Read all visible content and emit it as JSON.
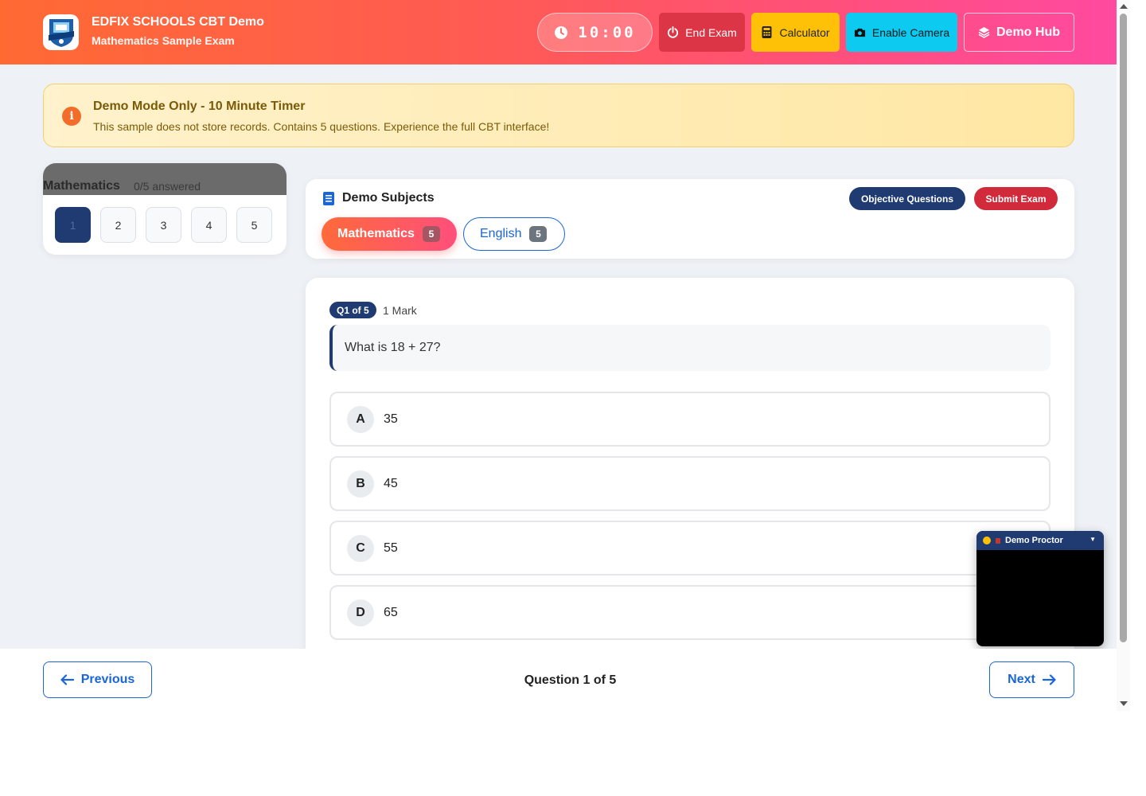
{
  "header": {
    "title": "EDFIX SCHOOLS CBT Demo",
    "subtitle": "Mathematics Sample Exam",
    "timer": "10:00",
    "end_exam_label": "End Exam",
    "calculator_label": "Calculator",
    "camera_label": "Enable Camera",
    "demo_hub_label": "Demo Hub"
  },
  "alert": {
    "title": "Demo Mode Only - 10 Minute Timer",
    "text": "This sample does not store records. Contains 5 questions. Experience the full CBT interface!"
  },
  "navigator": {
    "subject": "Mathematics",
    "answered": "0/5 answered",
    "questions": [
      "1",
      "2",
      "3",
      "4",
      "5"
    ],
    "active_index": 0
  },
  "subjects": {
    "title": "Demo Subjects",
    "objective_label": "Objective Questions",
    "submit_label": "Submit Exam",
    "tabs": [
      {
        "label": "Mathematics",
        "count": "5"
      },
      {
        "label": "English",
        "count": "5"
      }
    ]
  },
  "question": {
    "badge": "Q1 of 5",
    "marks": "1 Mark",
    "text": "What is 18 + 27?",
    "options": [
      {
        "letter": "A",
        "text": "35"
      },
      {
        "letter": "B",
        "text": "45"
      },
      {
        "letter": "C",
        "text": "55"
      },
      {
        "letter": "D",
        "text": "65"
      }
    ]
  },
  "proctor": {
    "title": "Demo Proctor"
  },
  "footer": {
    "previous_label": "Previous",
    "next_label": "Next",
    "position_label": "Question 1 of 5"
  },
  "colors": {
    "primary": "#1f3b72",
    "accent": "#ff5a55",
    "danger": "#dc3545",
    "warning": "#ffc107",
    "info": "#0dcaf0",
    "link": "#1a66d6"
  }
}
